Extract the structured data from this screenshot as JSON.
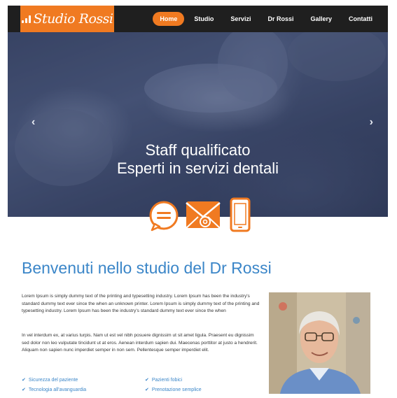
{
  "brand": {
    "name": "Studio Rossi",
    "primary": "#f07a21",
    "accent": "#3b86c8"
  },
  "nav": {
    "items": [
      {
        "label": "Home",
        "active": true
      },
      {
        "label": "Studio",
        "active": false
      },
      {
        "label": "Servizi",
        "active": false
      },
      {
        "label": "Dr Rossi",
        "active": false
      },
      {
        "label": "Gallery",
        "active": false
      },
      {
        "label": "Contatti",
        "active": false
      }
    ]
  },
  "hero": {
    "line1": "Staff qualificato",
    "line2": "Esperti in servizi dentali",
    "prev": "‹",
    "next": "›"
  },
  "contact_icons": [
    "chat-bubble-icon",
    "envelope-at-icon",
    "smartphone-icon"
  ],
  "welcome": {
    "title": "Benvenuti nello studio del Dr Rossi"
  },
  "intro": {
    "p1": "Lorem Ipsum is simply dummy text of the printing and typesetting industry. Lorem Ipsum has been the industry's standard dummy text ever since the when an unknown printer. Lorem Ipsum is simply dummy text of the printing and typesetting industry. Lorem Ipsum has been the industry's standard dummy text ever since the when",
    "p2": "In vel interdum ex, at varius turpis. Nam ut est vel nibh posuere dignissim ut sit amet ligula. Praesent eu dignissim sed dolor non leo vulputate tincidunt ut at eros. Aenean interdum sapien dui. Maecenas porttitor at justo a hendrerit. Aliquam non sapien nunc imperdiet semper in non sem. Pellentesque semper imperdiet elit."
  },
  "features": [
    {
      "label": "Sicurezza del paziente"
    },
    {
      "label": "Pazienti fobici"
    },
    {
      "label": "Tecnologia all'avanguardia"
    },
    {
      "label": "Prenotazione semplice"
    }
  ],
  "check_glyph": "✔"
}
